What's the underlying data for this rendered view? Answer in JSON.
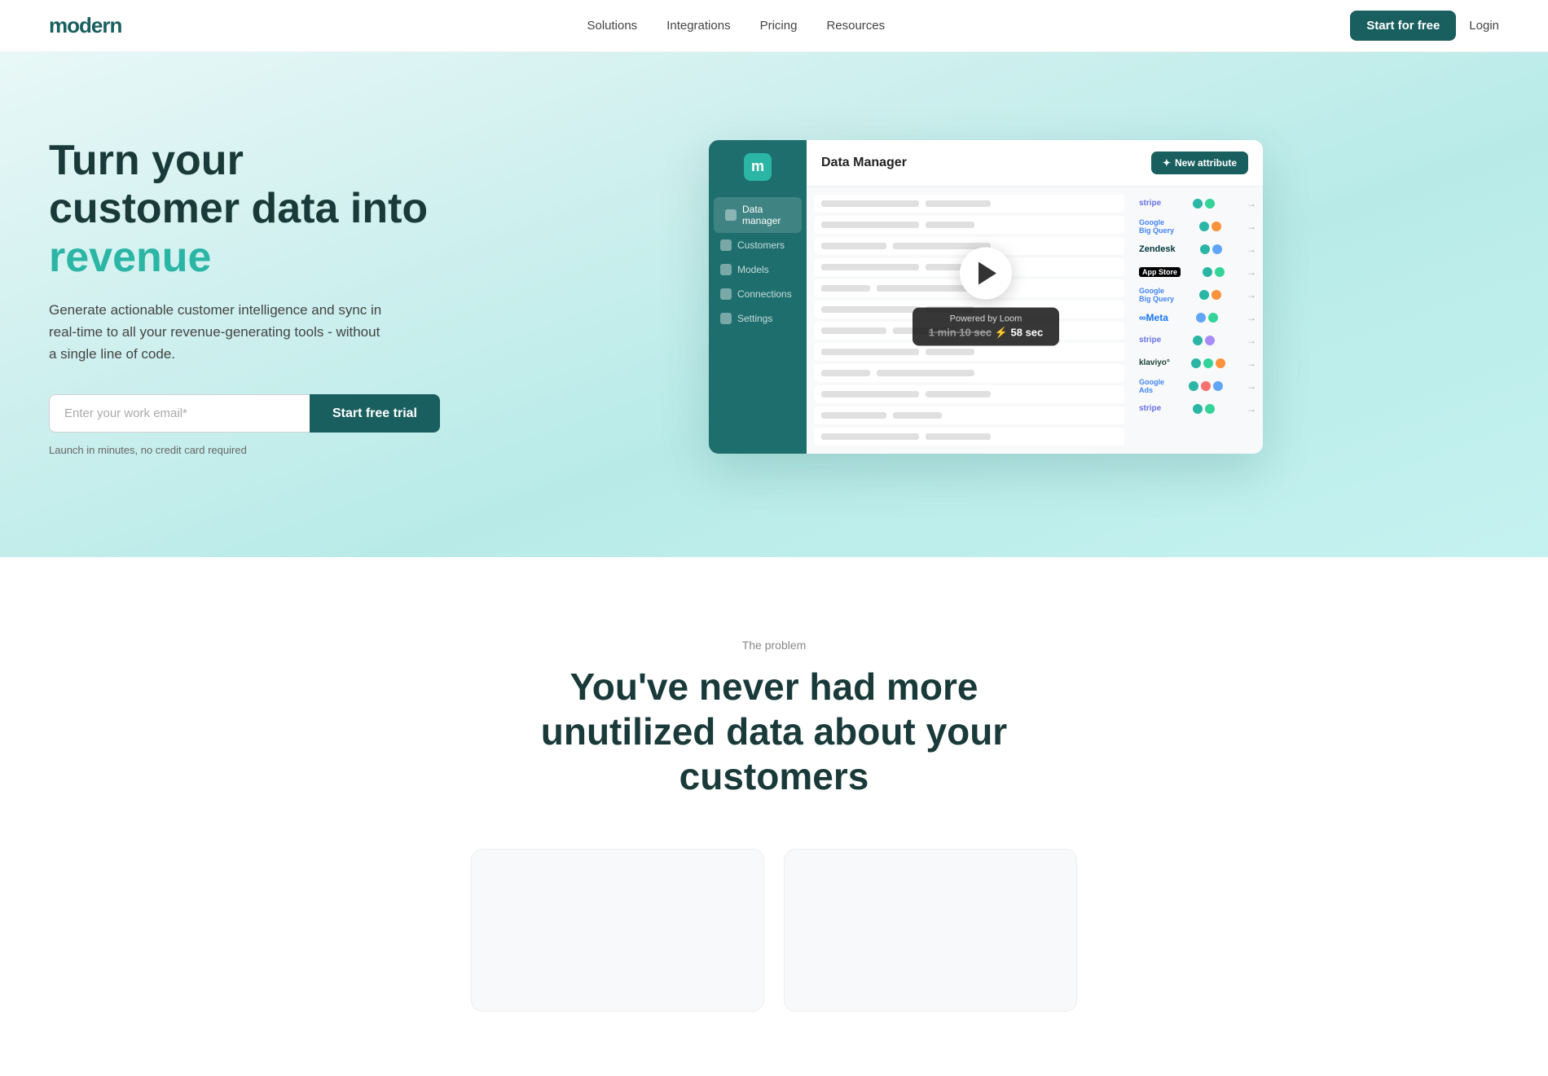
{
  "nav": {
    "logo": "modern",
    "links": [
      "Solutions",
      "Integrations",
      "Pricing",
      "Resources"
    ],
    "start_for_free": "Start for free",
    "login": "Login"
  },
  "hero": {
    "title_part1": "Turn your customer data into ",
    "title_accent": "revenue",
    "subtitle": "Generate actionable customer intelligence and sync in real-time to all your revenue-generating tools - without a single line of code.",
    "email_placeholder": "Enter your work email*",
    "cta_button": "Start free trial",
    "note": "Launch in minutes, no credit card required"
  },
  "app": {
    "sidebar_logo": "m",
    "nav_items": [
      "Data manager",
      "Customers",
      "Models",
      "Connections",
      "Settings"
    ],
    "header_title": "Data Manager",
    "new_attribute_btn": "New attribute",
    "loom_powered": "Powered by  Loom",
    "loom_time_old": "1 min 10 sec",
    "loom_time_new": "58 sec",
    "integrations": [
      {
        "name": "stripe",
        "label": "stripe"
      },
      {
        "name": "google-bq",
        "label": "Google Big Query"
      },
      {
        "name": "zendesk",
        "label": "Zendesk"
      },
      {
        "name": "app-store",
        "label": "App Store"
      },
      {
        "name": "google-bq2",
        "label": "Google Big Query"
      },
      {
        "name": "meta",
        "label": "Meta"
      },
      {
        "name": "stripe2",
        "label": "stripe"
      },
      {
        "name": "klaviyo",
        "label": "klaviyo"
      },
      {
        "name": "google-ads",
        "label": "Google Ads"
      },
      {
        "name": "stripe3",
        "label": "stripe"
      }
    ]
  },
  "problem": {
    "label": "The problem",
    "title": "You've never had more unutilized data about your customers"
  }
}
